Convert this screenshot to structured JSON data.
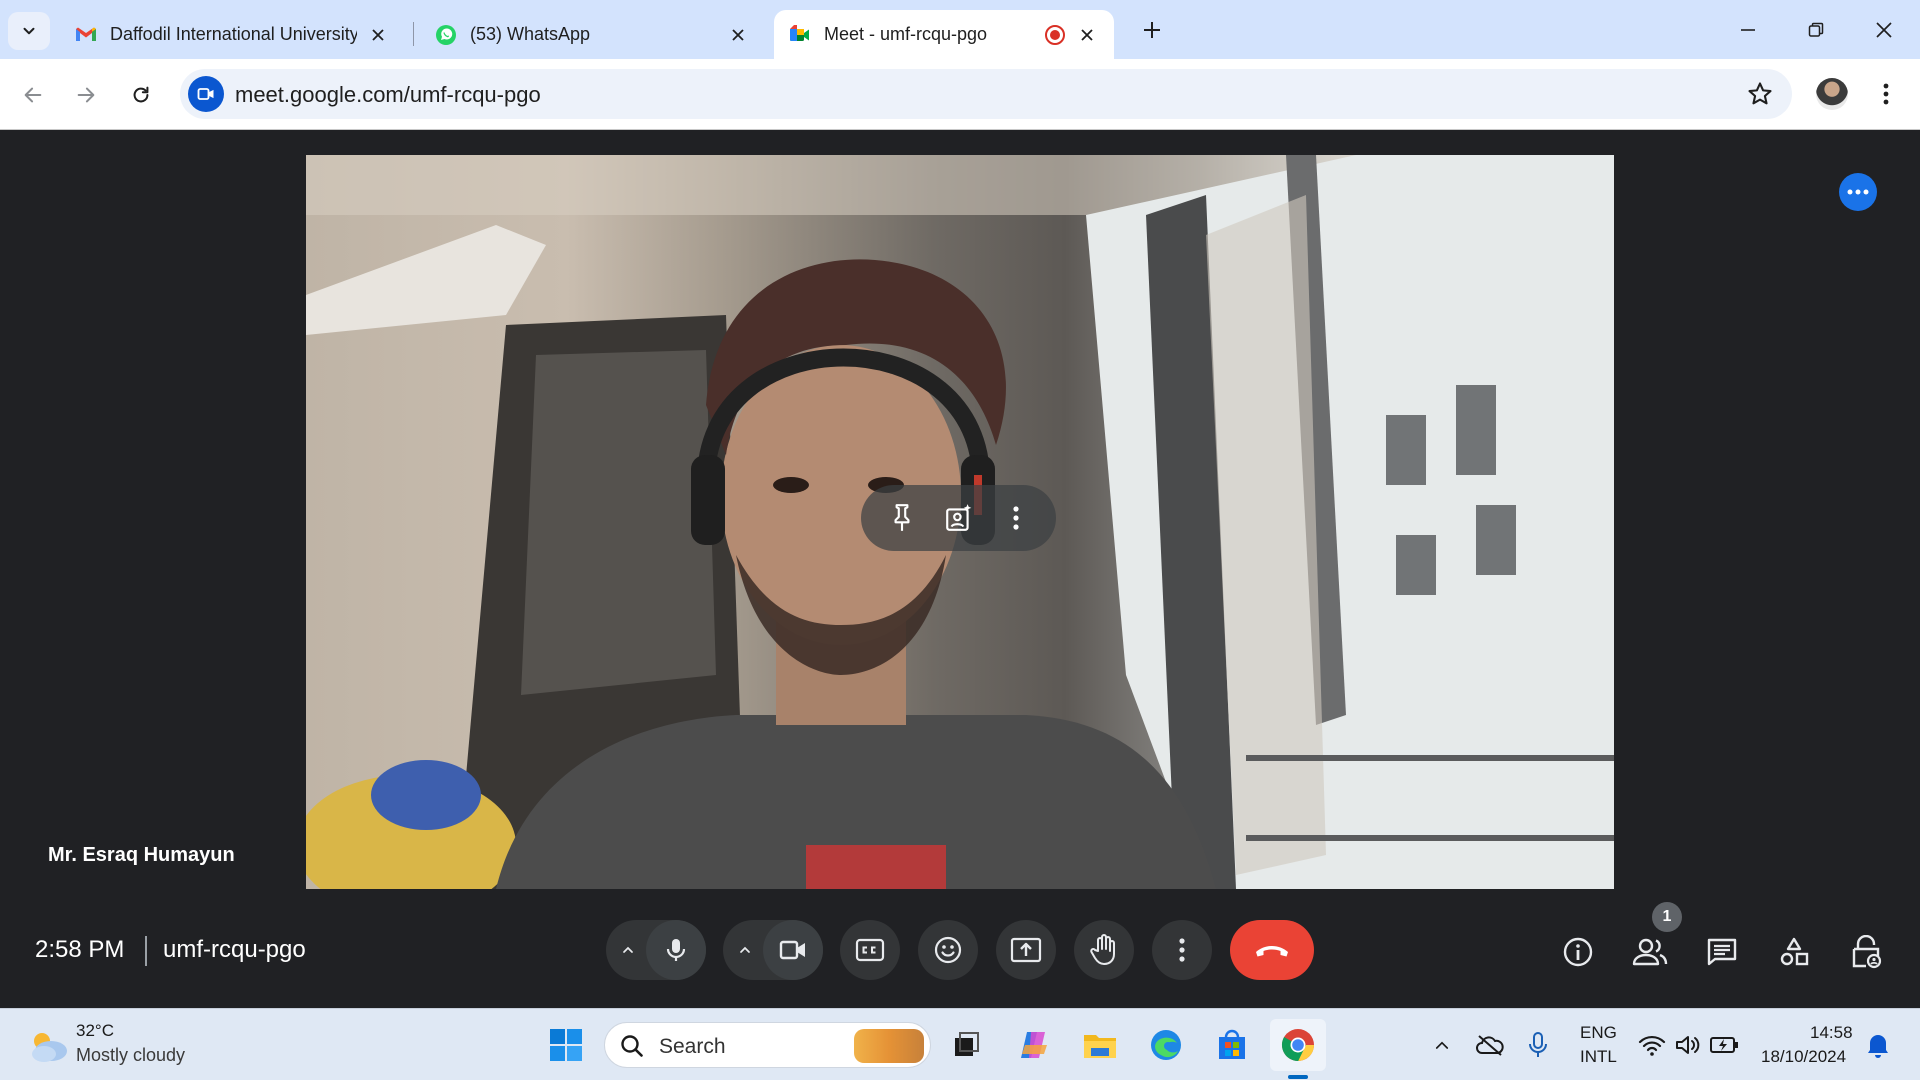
{
  "browser": {
    "tabs": [
      {
        "title": "Daffodil International University",
        "favicon": "gmail-icon",
        "active": false
      },
      {
        "title": "(53) WhatsApp",
        "favicon": "whatsapp-icon",
        "active": false
      },
      {
        "title": "Meet - umf-rcqu-pgo",
        "favicon": "google-meet-icon",
        "active": true,
        "recording": true
      }
    ],
    "url": "meet.google.com/umf-rcqu-pgo"
  },
  "meet": {
    "participant_name": "Mr. Esraq Humayun",
    "time": "2:58 PM",
    "meeting_code": "umf-rcqu-pgo",
    "people_count": "1",
    "colors": {
      "leave": "#ea4335",
      "accent": "#1a73e8",
      "bar_bg": "#202124"
    }
  },
  "taskbar": {
    "temperature": "32°C",
    "weather": "Mostly cloudy",
    "search_placeholder": "Search",
    "language_top": "ENG",
    "language_bottom": "INTL",
    "clock_time": "14:58",
    "clock_date": "18/10/2024"
  }
}
